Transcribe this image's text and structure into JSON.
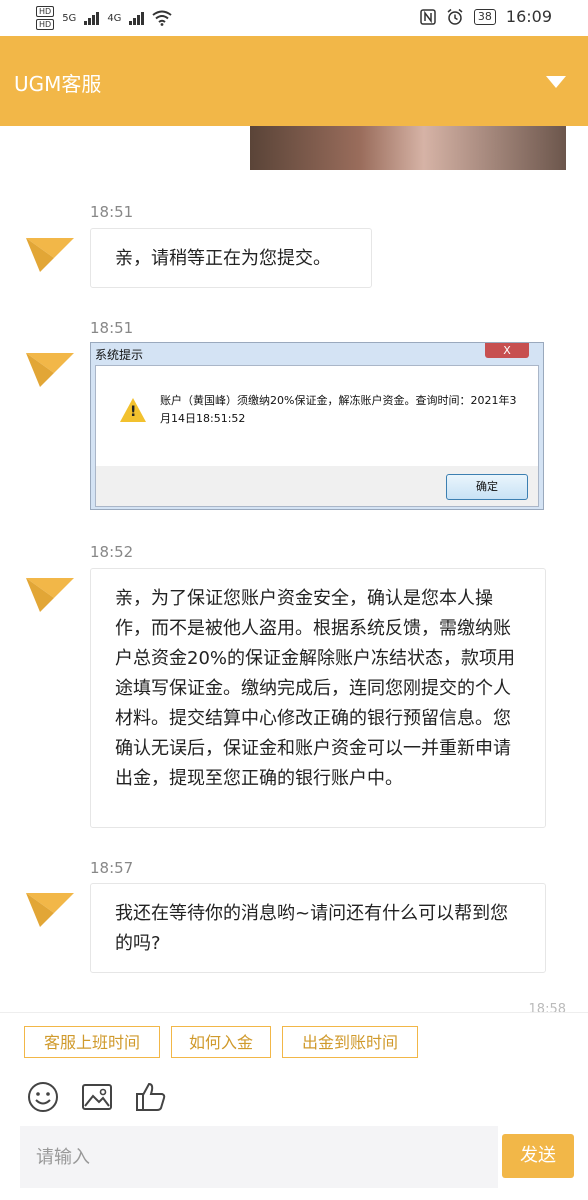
{
  "status_bar": {
    "left": {
      "hd1": "HD",
      "hd2": "HD",
      "net1": "5G",
      "net2": "4G"
    },
    "battery": "38",
    "time": "16:09"
  },
  "header": {
    "title": "UGM客服"
  },
  "messages": [
    {
      "time": "18:51",
      "text": "亲，请稍等正在为您提交。"
    },
    {
      "time": "18:51",
      "dialog": {
        "caption": "系统提示",
        "close": "X",
        "message": "账户（黄国峰）须缴纳20%保证金，解冻账户资金。查询时间：2021年3月14日18:51:52",
        "ok": "确定"
      }
    },
    {
      "time": "18:52",
      "text": "亲，为了保证您账户资金安全，确认是您本人操作，而不是被他人盗用。根据系统反馈，需缴纳账户总资金20%的保证金解除账户冻结状态，款项用途填写保证金。缴纳完成后，连同您刚提交的个人材料。提交结算中心修改正确的银行预留信息。您确认无误后，保证金和账户资金可以一并重新申请出金，提现至您正确的银行账户中。"
    },
    {
      "time": "18:57",
      "text": "我还在等待你的消息哟~请问还有什么可以帮到您的吗?"
    }
  ],
  "partial_time": "18:58",
  "quick_replies": [
    "客服上班时间",
    "如何入金",
    "出金到账时间"
  ],
  "input": {
    "placeholder": "请输入"
  },
  "send_label": "发送",
  "colors": {
    "accent": "#f2b748",
    "avatar_dark": "#3b2e26"
  }
}
